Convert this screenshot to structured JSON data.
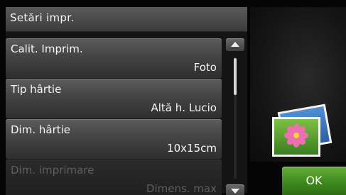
{
  "panel": {
    "title": "Setări impr."
  },
  "settings": [
    {
      "label": "Calit. Imprim.",
      "value": "Foto",
      "enabled": true
    },
    {
      "label": "Tip hârtie",
      "value": "Altă h. Lucio",
      "enabled": true
    },
    {
      "label": "Dim. hârtie",
      "value": "10x15cm",
      "enabled": true
    },
    {
      "label": "Dim. imprimare",
      "value": "Dimens. max",
      "enabled": false
    }
  ],
  "actions": {
    "ok_label": "OK"
  },
  "icons": {
    "scroll_up": "triangle-up-icon",
    "scroll_down": "triangle-down-icon",
    "preview": "photo-stack-icon"
  },
  "colors": {
    "accent_ok": "#3f8a1f",
    "row_bg": "#444444",
    "disabled_text": "#5e5e5e"
  }
}
